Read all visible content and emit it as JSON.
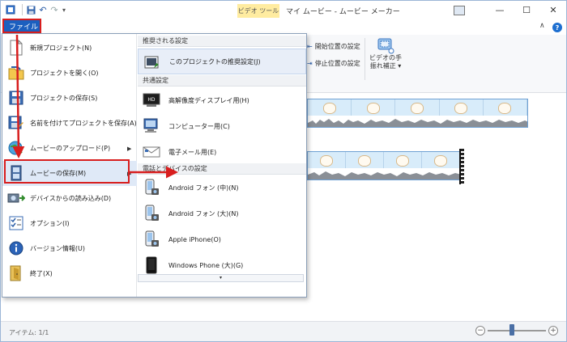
{
  "app": {
    "title": "マイ ムービー - ムービー メーカー",
    "context_tab": "ビデオ ツール"
  },
  "window_controls": {
    "minimize": "—",
    "maximize": "☐",
    "close": "✕"
  },
  "help": {
    "label": "?"
  },
  "ribbon": {
    "set_start": "開始位置の設定",
    "set_end": "停止位置の設定",
    "stabilize_line1": "ビデオの手",
    "stabilize_line2": "振れ補正 ▾"
  },
  "file_menu": {
    "tab_label": "ファイル",
    "items": [
      {
        "label": "新規プロジェクト(N)"
      },
      {
        "label": "プロジェクトを開く(O)"
      },
      {
        "label": "プロジェクトの保存(S)"
      },
      {
        "label": "名前を付けてプロジェクトを保存(A)"
      },
      {
        "label": "ムービーのアップロード(P)",
        "submenu": true
      },
      {
        "label": "ムービーの保存(M)",
        "submenu": true,
        "active": true
      },
      {
        "label": "デバイスからの読み込み(D)"
      },
      {
        "label": "オプション(I)"
      },
      {
        "label": "バージョン情報(U)"
      },
      {
        "label": "終了(X)"
      }
    ]
  },
  "save_movie_submenu": {
    "section_recommended": "推奨される設定",
    "recommended_item": "このプロジェクトの推奨設定(J)",
    "section_common": "共通設定",
    "common_items": [
      {
        "label": "高解像度ディスプレイ用(H)"
      },
      {
        "label": "コンピューター用(C)"
      },
      {
        "label": "電子メール用(E)"
      }
    ],
    "section_devices": "電話とデバイスの設定",
    "device_items": [
      {
        "label": "Android フォン (中)(N)"
      },
      {
        "label": "Android フォン (大)(N)"
      },
      {
        "label": "Apple iPhone(O)"
      },
      {
        "label": "Windows Phone (大)(G)"
      }
    ],
    "scroll_indicator": "▾"
  },
  "statusbar": {
    "items_label": "アイテム: 1/1",
    "zoom_minus": "−",
    "zoom_plus": "+",
    "zoom_level": 0.42
  },
  "colors": {
    "accent": "#1b5fbf",
    "annotation_red": "#d81e1e",
    "clip_border": "#6fa1d4"
  }
}
